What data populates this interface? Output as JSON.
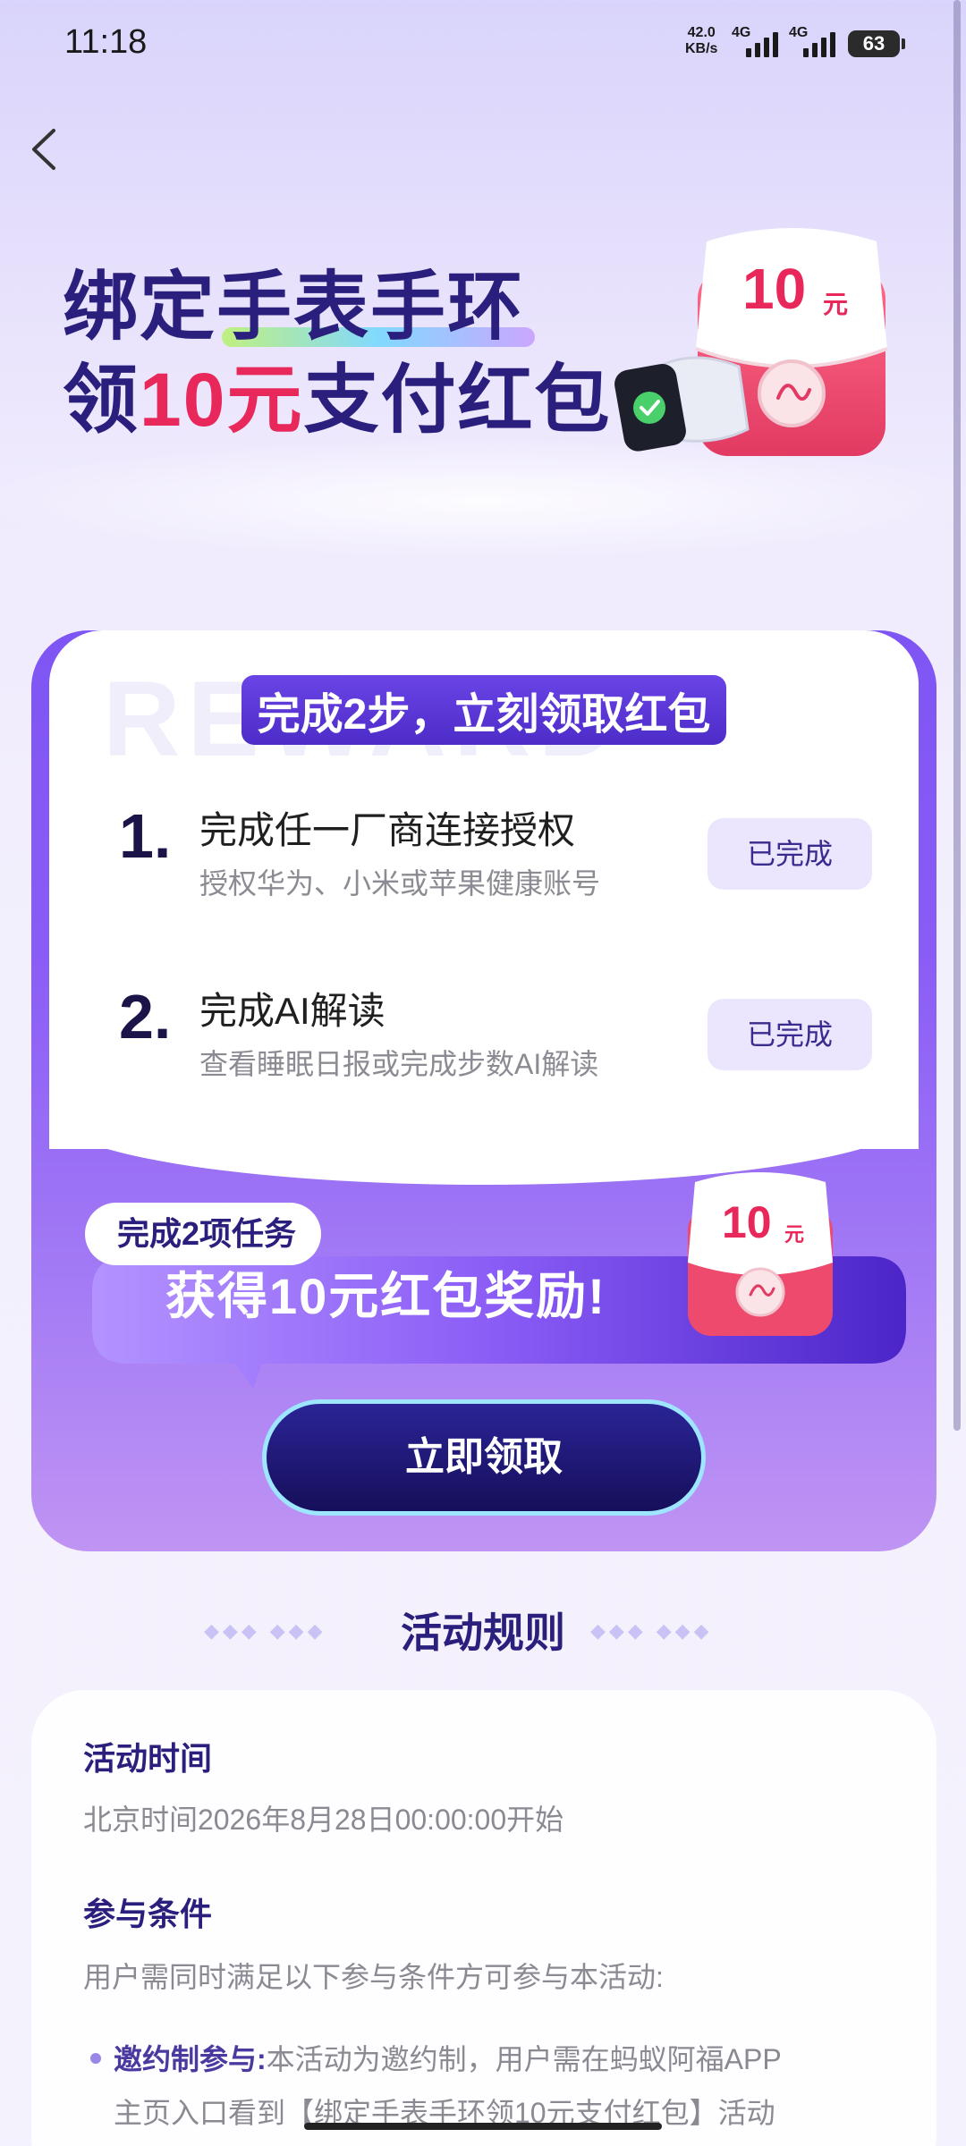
{
  "status_bar": {
    "time": "11:18",
    "net_speed_value": "42.0",
    "net_speed_unit": "KB/s",
    "signal1_label": "4G",
    "signal2_label": "4G",
    "battery": "63"
  },
  "hero": {
    "line1": "绑定手表手环",
    "line2_prefix": "领",
    "line2_highlight": "10元",
    "line2_suffix": "支付红包",
    "gift_amount": "10",
    "gift_unit": "元"
  },
  "task_card": {
    "bg_word": "REWARD",
    "title": "完成2步，立刻领取红包",
    "steps": [
      {
        "num": "1.",
        "title": "完成任一厂商连接授权",
        "subtitle": "授权华为、小米或苹果健康账号",
        "status": "已完成"
      },
      {
        "num": "2.",
        "title": "完成AI解读",
        "subtitle": "查看睡眠日报或完成步数AI解读",
        "status": "已完成"
      }
    ],
    "reward_pill": "完成2项任务",
    "reward_text": "获得10元红包奖励!",
    "gift_amount": "10",
    "gift_unit": "元",
    "claim_button": "立即领取"
  },
  "rules": {
    "heading": "活动规则",
    "time_heading": "活动时间",
    "time_text": "北京时间2026年8月28日00:00:00开始",
    "cond_heading": "参与条件",
    "cond_text": "用户需同时满足以下参与条件方可参与本活动:",
    "bullet1_label": "邀约制参与:",
    "bullet1_text": "本活动为邀约制，用户需在蚂蚁阿福APP",
    "bullet1_text2": "主页入口看到【绑定手表手环领10元支付红包】活动"
  },
  "colors": {
    "brand_deep": "#2a1f7c",
    "accent_red": "#e8285a",
    "card_purple": "#8a5cf6",
    "done_bg": "#ebe6fd"
  }
}
